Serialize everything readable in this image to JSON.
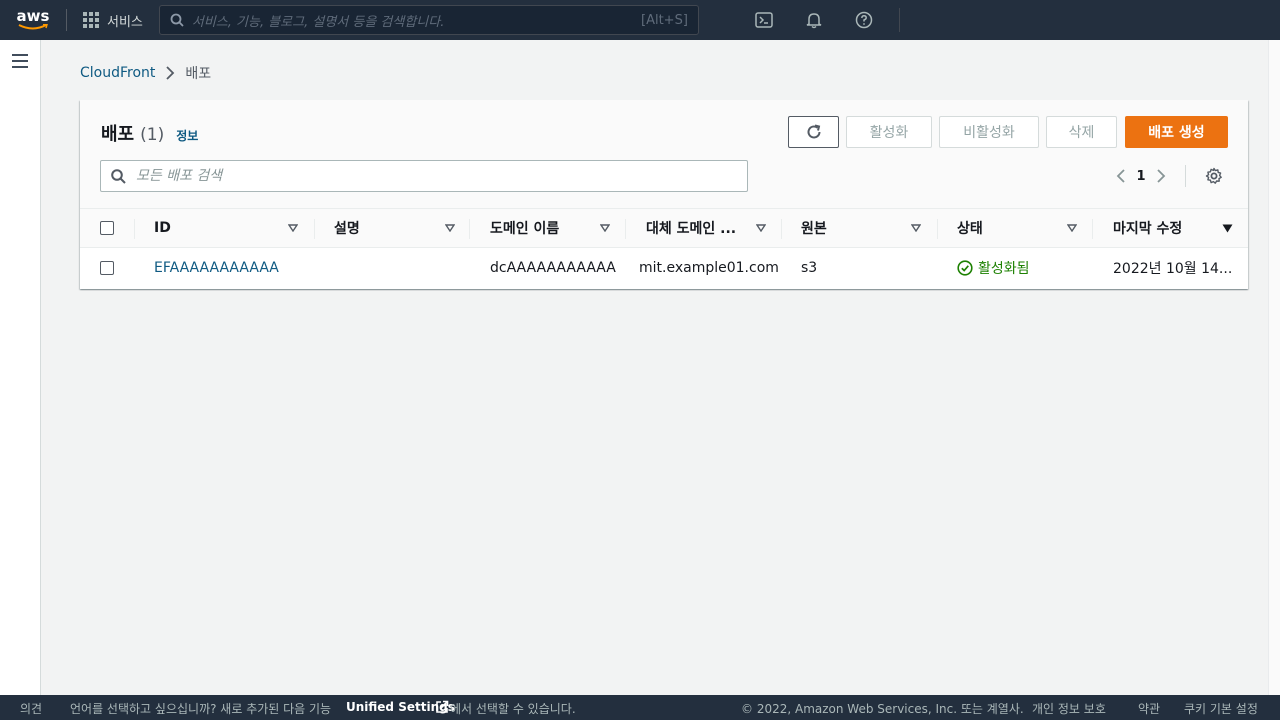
{
  "topnav": {
    "logo": "aws",
    "services_label": "서비스",
    "search_placeholder": "서비스, 기능, 블로그, 설명서 등을 검색합니다.",
    "search_shortcut": "[Alt+S]",
    "icons": [
      "cloudshell-icon",
      "bell-icon",
      "help-icon"
    ]
  },
  "breadcrumb": {
    "root": "CloudFront",
    "current": "배포"
  },
  "panel": {
    "title": "배포",
    "count": "(1)",
    "info": "정보",
    "buttons": {
      "activate": "활성화",
      "deactivate": "비활성화",
      "delete": "삭제",
      "create": "배포 생성"
    },
    "filter_placeholder": "모든 배포 검색",
    "page": "1"
  },
  "table": {
    "columns": [
      "ID",
      "설명",
      "도메인 이름",
      "대체 도메인 ...",
      "원본",
      "상태",
      "마지막 수정"
    ],
    "rows": [
      {
        "id": "EFAAAAAAAAAAA",
        "description": "",
        "domain": "dcAAAAAAAAAAA",
        "alt_domain": "mit.example01.com",
        "origin": "s3",
        "status": "활성화됨",
        "modified": "2022년 10월 14..."
      }
    ]
  },
  "footer": {
    "feedback": "의견",
    "language_text": "언어를 선택하고 싶으십니까? 새로 추가된 다음 기능",
    "unified_settings": "Unified Settings",
    "language_text2": "에서 선택할 수 있습니다.",
    "copyright": "© 2022, Amazon Web Services, Inc. 또는 계열사.",
    "privacy": "개인 정보 보호",
    "terms": "약관",
    "cookies": "쿠키 기본 설정"
  },
  "colors": {
    "nav_bg": "#232f3e",
    "primary": "#ec7211",
    "link": "#0f5a82",
    "success": "#1d8102"
  }
}
